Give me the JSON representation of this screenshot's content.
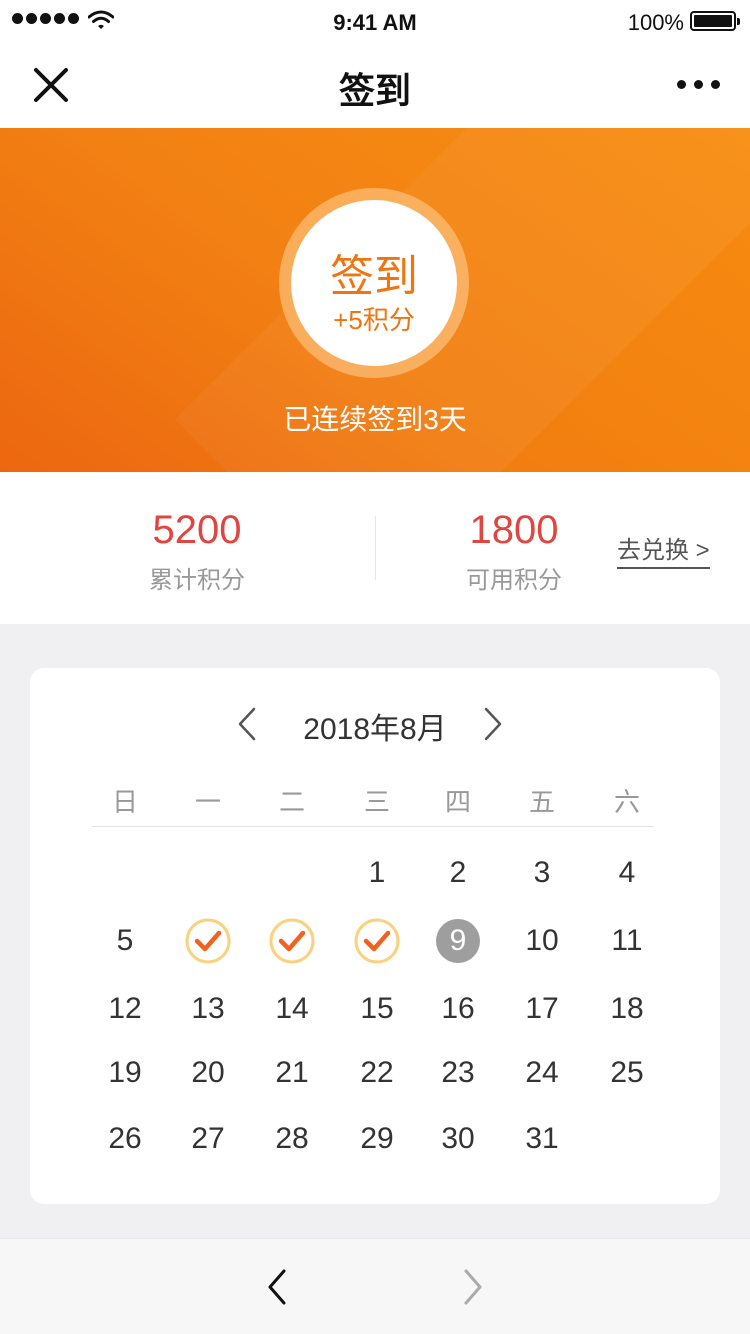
{
  "status_bar": {
    "time": "9:41 AM",
    "battery": "100%"
  },
  "nav": {
    "title": "签到"
  },
  "hero": {
    "sign_label": "签到",
    "sign_points": "+5积分",
    "streak_text": "已连续签到3天"
  },
  "points": {
    "total_value": "5200",
    "total_label": "累计积分",
    "available_value": "1800",
    "available_label": "可用积分",
    "redeem_label": "去兑换 >"
  },
  "calendar": {
    "title": "2018年8月",
    "weekdays": [
      "日",
      "一",
      "二",
      "三",
      "四",
      "五",
      "六"
    ],
    "checked_days": [
      6,
      7,
      8
    ],
    "today": 9,
    "weeks": [
      [
        "",
        "",
        "",
        "1",
        "2",
        "3",
        "4"
      ],
      [
        "5",
        "6",
        "7",
        "8",
        "9",
        "10",
        "11"
      ],
      [
        "12",
        "13",
        "14",
        "15",
        "16",
        "17",
        "18"
      ],
      [
        "19",
        "20",
        "21",
        "22",
        "23",
        "24",
        "25"
      ],
      [
        "26",
        "27",
        "28",
        "29",
        "30",
        "31",
        ""
      ]
    ]
  },
  "colors": {
    "accent": "#f07410",
    "points_value": "#e0453f",
    "today_bg": "#9e9e9e"
  }
}
